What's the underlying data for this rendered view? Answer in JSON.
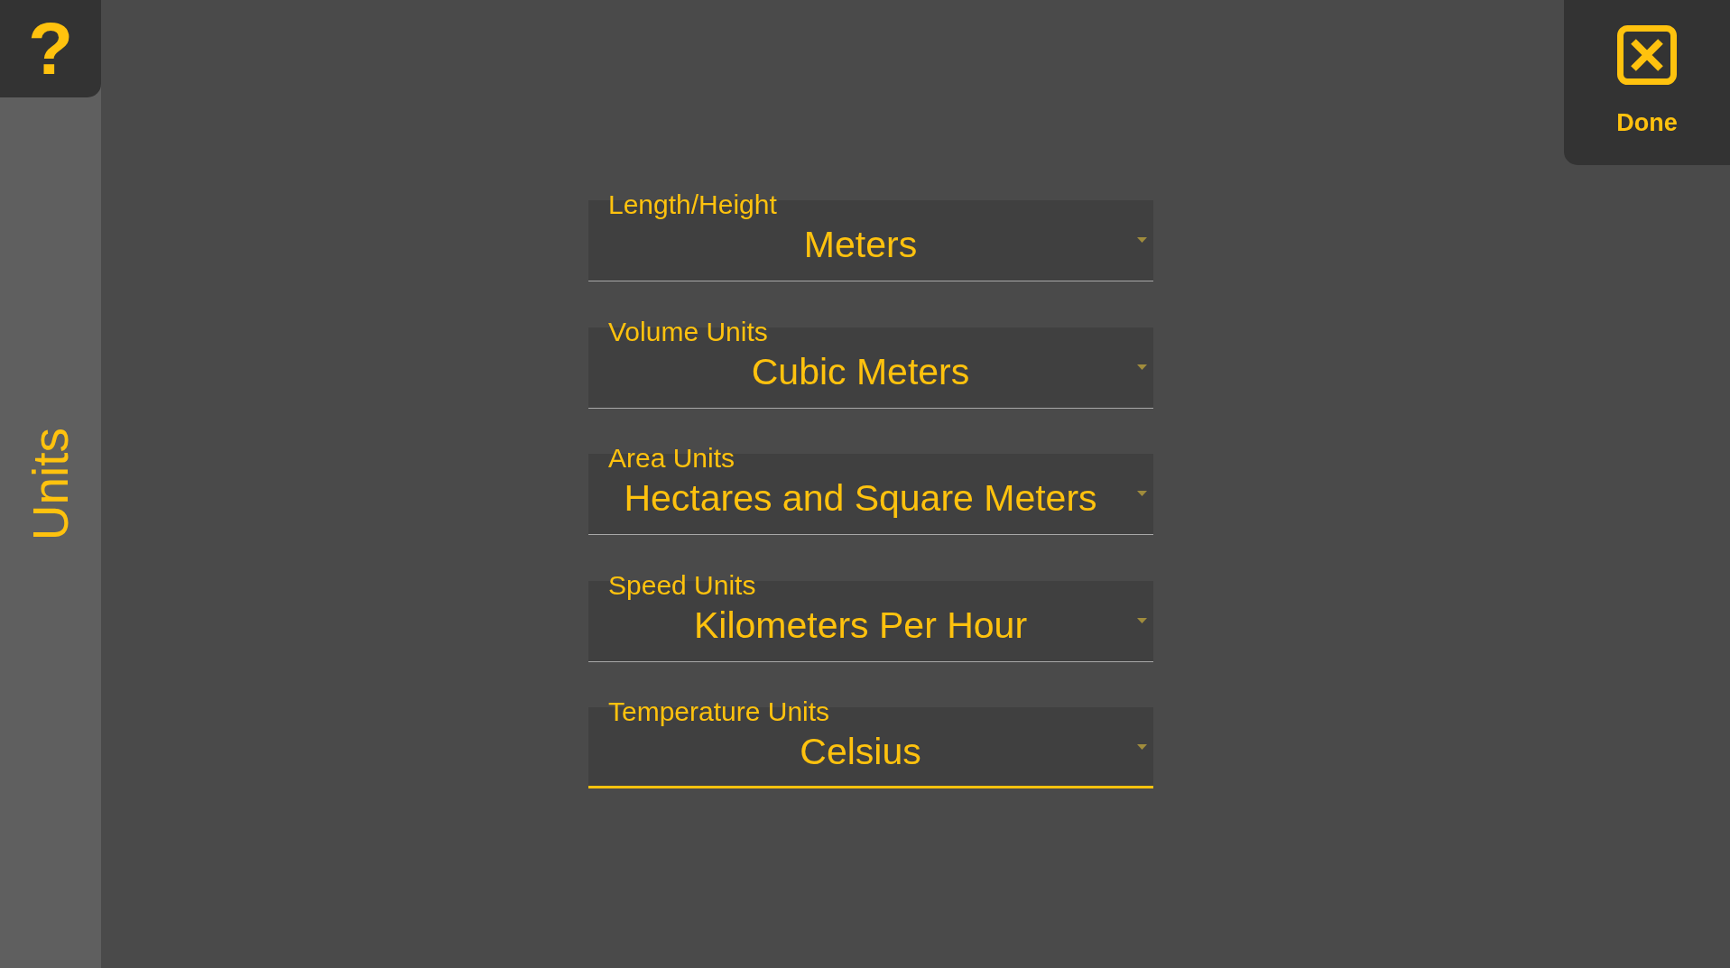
{
  "help_button": {
    "label": "?"
  },
  "sidebar": {
    "title": "Units"
  },
  "done_button": {
    "label": "Done"
  },
  "fields": [
    {
      "label": "Length/Height",
      "value": "Meters",
      "focused": false
    },
    {
      "label": "Volume Units",
      "value": "Cubic Meters",
      "focused": false
    },
    {
      "label": "Area Units",
      "value": "Hectares and Square Meters",
      "focused": false
    },
    {
      "label": "Speed Units",
      "value": "Kilometers Per Hour",
      "focused": false
    },
    {
      "label": "Temperature Units",
      "value": "Celsius",
      "focused": true
    }
  ]
}
